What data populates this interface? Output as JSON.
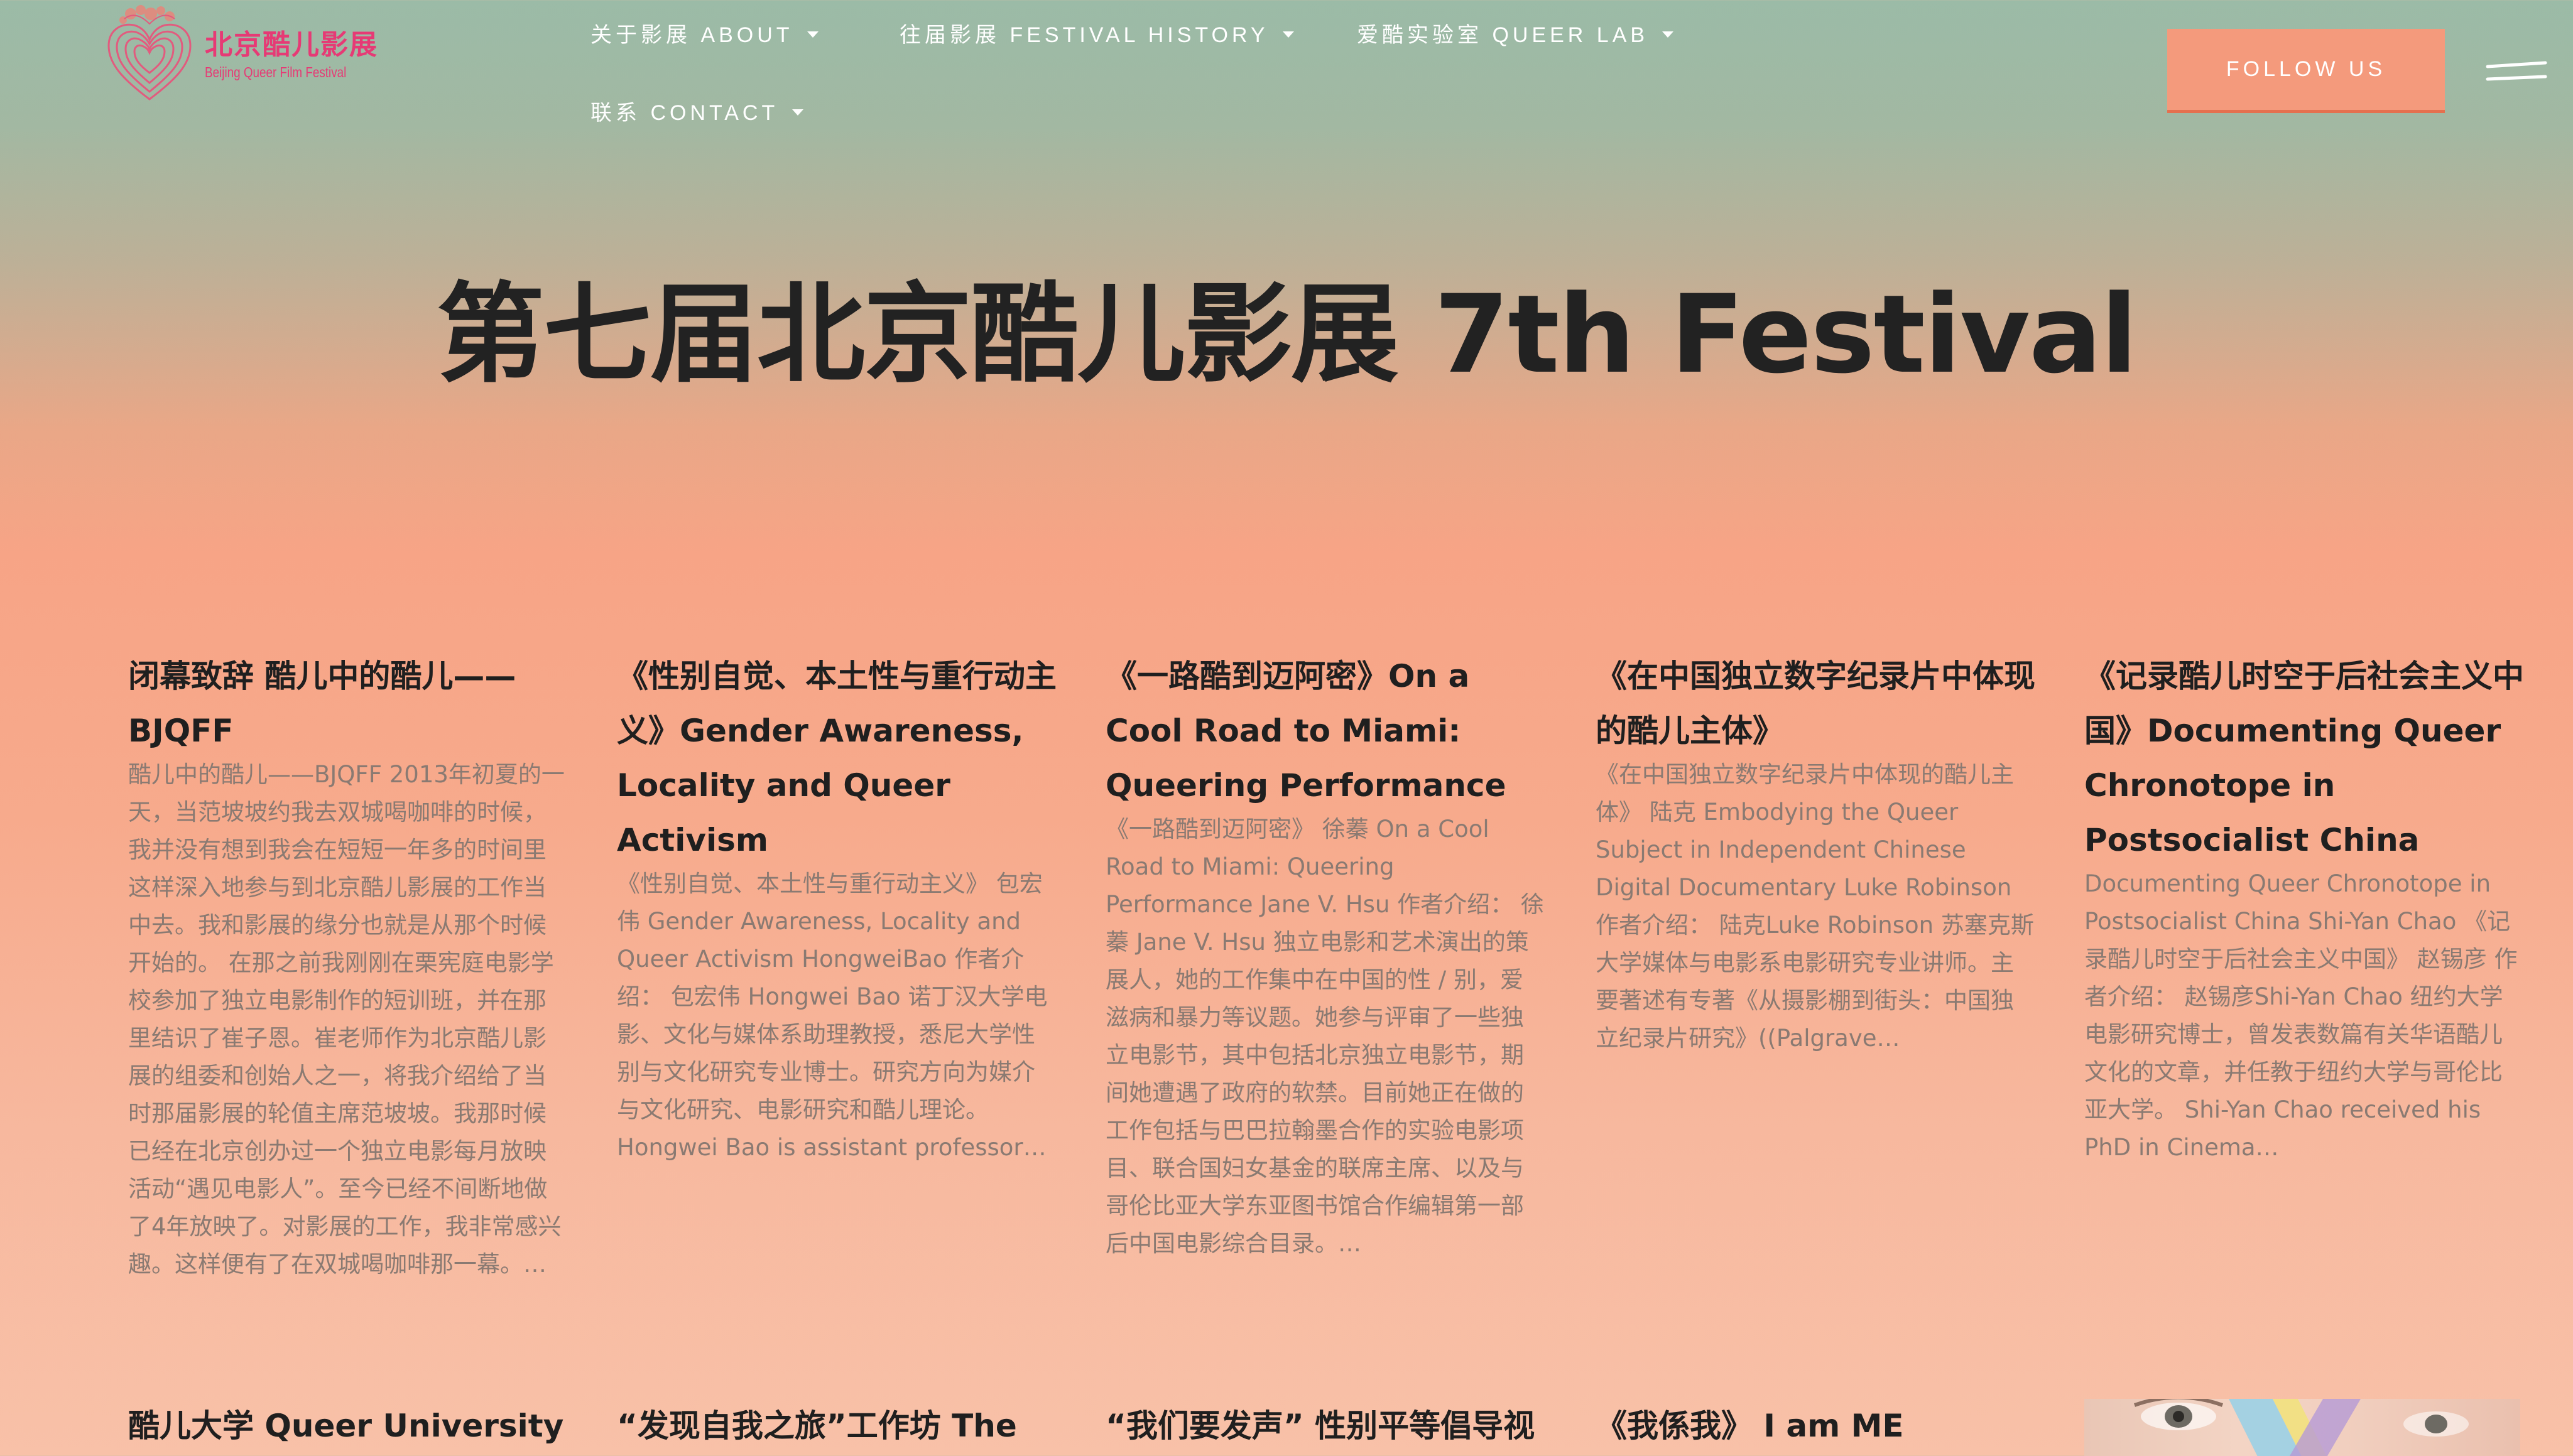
{
  "header": {
    "logo": {
      "name_cn": "北京酷儿影展",
      "name_en": "Beijing Queer Film Festival"
    },
    "nav": [
      {
        "label": "关于影展 ABOUT"
      },
      {
        "label": "往届影展 FESTIVAL HISTORY"
      },
      {
        "label": "爱酷实验室 QUEER LAB"
      },
      {
        "label": "联系 CONTACT"
      }
    ],
    "follow_label": "FOLLOW US"
  },
  "page": {
    "title": "第七届北京酷儿影展 7th Festival"
  },
  "posts": [
    {
      "title": "闭幕致辞 酷儿中的酷儿——BJQFF",
      "excerpt": "酷儿中的酷儿——BJQFF   2013年初夏的一天，当范坡坡约我去双城喝咖啡的时候，我并没有想到我会在短短一年多的时间里这样深入地参与到北京酷儿影展的工作当中去。我和影展的缘分也就是从那个时候开始的。   在那之前我刚刚在栗宪庭电影学校参加了独立电影制作的短训班，并在那里结识了崔子恩。崔老师作为北京酷儿影展的组委和创始人之一，将我介绍给了当时那届影展的轮值主席范坡坡。我那时候已经在北京创办过一个独立电影每月放映活动“遇见电影人”。至今已经不间断地做了4年放映了。对影展的工作，我非常感兴趣。这样便有了在双城喝咖啡那一幕。…"
    },
    {
      "title": "《性别自觉、本土性与重行动主义》Gender Awareness, Locality and Queer Activism",
      "excerpt": "《性别自觉、本土性与重行动主义》 包宏伟   Gender Awareness, Locality and Queer Activism HongweiBao 作者介绍： 包宏伟 Hongwei Bao 诺丁汉大学电影、文化与媒体系助理教授，悉尼大学性别与文化研究专业博士。研究方向为媒介与文化研究、电影研究和酷儿理论。 Hongwei Bao is assistant professor…"
    },
    {
      "title": "《一路酷到迈阿密》On a Cool Road to Miami: Queering Performance",
      "excerpt": "《一路酷到迈阿密》 徐蓁   On a Cool Road to Miami: Queering Performance Jane V. Hsu   作者介绍： 徐蓁 Jane V. Hsu 独立电影和艺术演出的策展人，她的工作集中在中国的性 / 别，爱滋病和暴力等议题。她参与评审了一些独立电影节，其中包括北京独立电影节，期间她遭遇了政府的软禁。目前她正在做的工作包括与巴巴拉翰墨合作的实验电影项目、联合国妇女基金的联席主席、以及与哥伦比亚大学东亚图书馆合作编辑第一部后中国电影综合目录。…"
    },
    {
      "title": "《在中国独立数字纪录片中体现的酷儿主体》",
      "excerpt": "《在中国独立数字纪录片中体现的酷儿主体》 陆克   Embodying the Queer Subject in Independent Chinese Digital Documentary Luke Robinson   作者介绍： 陆克Luke Robinson 苏塞克斯大学媒体与电影系电影研究专业讲师。主要著述有专著《从摄影棚到街头：中国独立纪录片研究》((Palgrave…"
    },
    {
      "title": "《记录酷儿时空于后社会主义中国》Documenting Queer Chronotope in Postsocialist China",
      "excerpt": "Documenting Queer Chronotope in Postsocialist China Shi-Yan Chao 《记录酷儿时空于后社会主义中国》 赵锡彦   作者介绍： 赵锡彦Shi-Yan Chao 纽约大学电影研究博士，曾发表数篇有关华语酷儿文化的文章，并任教于纽约大学与哥伦比亚大学。 Shi-Yan Chao received his PhD in Cinema…"
    },
    {
      "title": "酷儿大学 Queer University",
      "excerpt": ""
    },
    {
      "title": "“发现自我之旅”工作坊 The",
      "excerpt": ""
    },
    {
      "title": "“我们要发声” 性别平等倡导视",
      "excerpt": ""
    },
    {
      "title": "《我係我》 I am ME",
      "excerpt": ""
    }
  ]
}
